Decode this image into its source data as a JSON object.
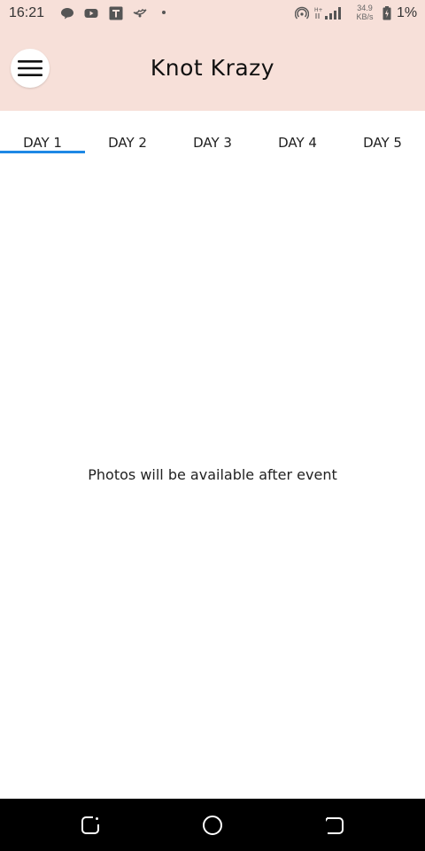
{
  "status_bar": {
    "time": "16:21",
    "net_speed_value": "34.9",
    "net_speed_unit": "KB/s",
    "battery": "1%",
    "icons": [
      "chat-icon",
      "youtube-icon",
      "t-app-icon",
      "bird-app-icon",
      "hotspot-icon",
      "signal-icon",
      "battery-charging-icon"
    ]
  },
  "app_bar": {
    "title": "Knot Krazy",
    "background": "#f7e0d9"
  },
  "tabs": {
    "items": [
      {
        "label": "DAY 1",
        "active": true
      },
      {
        "label": "DAY 2",
        "active": false
      },
      {
        "label": "DAY 3",
        "active": false
      },
      {
        "label": "DAY 4",
        "active": false
      },
      {
        "label": "DAY 5",
        "active": false
      }
    ],
    "indicator_color": "#1e88e5"
  },
  "content": {
    "empty_message": "Photos will be available after event"
  },
  "nav_bar": {
    "buttons": [
      "recents-icon",
      "home-icon",
      "back-icon"
    ]
  }
}
